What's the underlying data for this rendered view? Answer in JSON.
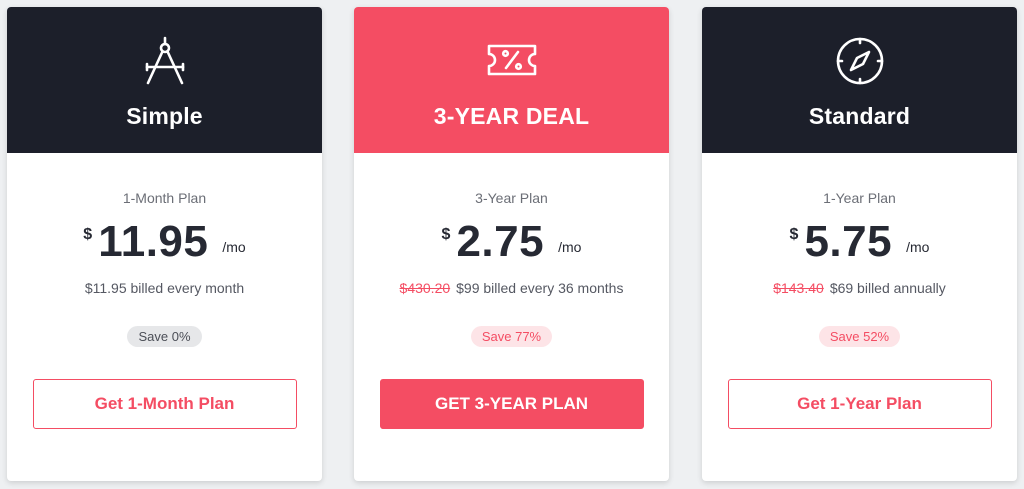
{
  "colors": {
    "accent": "#f44d63",
    "dark": "#1c1f2a",
    "card_bg": "#ffffff"
  },
  "plans": [
    {
      "icon": "compass-drafting-icon",
      "title": "Simple",
      "plan_name": "1-Month Plan",
      "currency": "$",
      "amount": "11.95",
      "per": "/mo",
      "old_price": "",
      "billing": "$11.95 billed every month",
      "save_label": "Save 0%",
      "cta_label": "Get 1-Month Plan"
    },
    {
      "icon": "discount-ticket-icon",
      "title": "3-YEAR DEAL",
      "plan_name": "3-Year Plan",
      "currency": "$",
      "amount": "2.75",
      "per": "/mo",
      "old_price": "$430.20",
      "billing": "$99 billed every 36 months",
      "save_label": "Save 77%",
      "cta_label": "GET 3-YEAR PLAN"
    },
    {
      "icon": "navigation-compass-icon",
      "title": "Standard",
      "plan_name": "1-Year Plan",
      "currency": "$",
      "amount": "5.75",
      "per": "/mo",
      "old_price": "$143.40",
      "billing": "$69 billed annually",
      "save_label": "Save 52%",
      "cta_label": "Get 1-Year Plan"
    }
  ]
}
